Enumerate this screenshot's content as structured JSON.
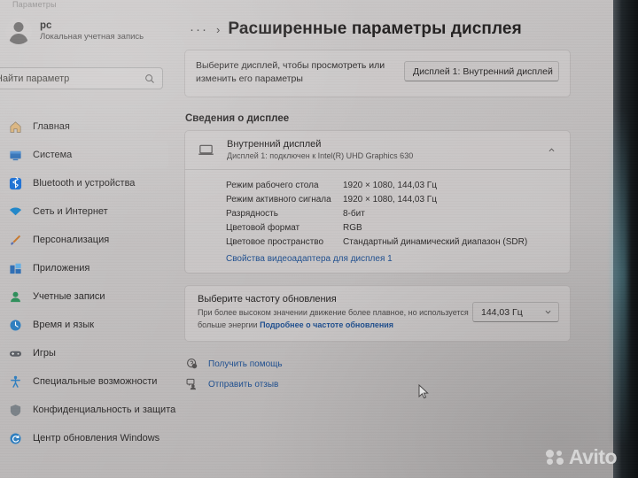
{
  "window": {
    "app_title": "Параметры"
  },
  "sidebar": {
    "account": {
      "name": "pc",
      "subtitle": "Локальная учетная запись",
      "avatar_icon": "user-avatar"
    },
    "search": {
      "value": "",
      "placeholder": "Найти параметр",
      "icon": "search-icon"
    },
    "items": [
      {
        "label": "Главная",
        "icon": "home-icon",
        "active": false
      },
      {
        "label": "Система",
        "icon": "system-icon",
        "active": true
      },
      {
        "label": "Bluetooth и устройства",
        "icon": "bluetooth-icon",
        "active": false
      },
      {
        "label": "Сеть и Интернет",
        "icon": "network-icon",
        "active": false
      },
      {
        "label": "Персонализация",
        "icon": "brush-icon",
        "active": false
      },
      {
        "label": "Приложения",
        "icon": "apps-icon",
        "active": false
      },
      {
        "label": "Учетные записи",
        "icon": "accounts-icon",
        "active": false
      },
      {
        "label": "Время и язык",
        "icon": "clock-icon",
        "active": false
      },
      {
        "label": "Игры",
        "icon": "gaming-icon",
        "active": false
      },
      {
        "label": "Специальные возможности",
        "icon": "accessibility-icon",
        "active": false
      },
      {
        "label": "Конфиденциальность и защита",
        "icon": "shield-icon",
        "active": false
      },
      {
        "label": "Центр обновления Windows",
        "icon": "update-icon",
        "active": false
      }
    ]
  },
  "content": {
    "breadcrumb": {
      "dots": "···",
      "separator": "›",
      "title": "Расширенные параметры дисплея"
    },
    "display_selector": {
      "description": "Выберите дисплей, чтобы просмотреть или изменить его параметры",
      "dropdown_value": "Дисплей 1: Внутренний дисплей",
      "chevron_icon": "chevron-down-icon"
    },
    "display_info": {
      "section_title": "Сведения о дисплее",
      "monitor_icon": "laptop-monitor-icon",
      "name": "Внутренний дисплей",
      "connection": "Дисплей 1: подключен к Intel(R) UHD Graphics 630",
      "collapse_icon": "chevron-up-icon",
      "specs": [
        {
          "key": "Режим рабочего стола",
          "value": "1920 × 1080, 144,03 Гц"
        },
        {
          "key": "Режим активного сигнала",
          "value": "1920 × 1080, 144,03 Гц"
        },
        {
          "key": "Разрядность",
          "value": "8-бит"
        },
        {
          "key": "Цветовой формат",
          "value": "RGB"
        },
        {
          "key": "Цветовое пространство",
          "value": "Стандартный динамический диапазон (SDR)"
        }
      ],
      "adapter_link": "Свойства видеоадаптера для дисплея 1"
    },
    "refresh_rate": {
      "title": "Выберите частоту обновления",
      "description": "При более высоком значении движение более плавное, но используется больше энергии",
      "learn_more": "Подробнее о частоте обновления",
      "dropdown_value": "144,03 Гц",
      "chevron_icon": "chevron-down-icon"
    },
    "help_links": [
      {
        "label": "Получить помощь",
        "icon": "get-help-icon"
      },
      {
        "label": "Отправить отзыв",
        "icon": "send-feedback-icon"
      }
    ]
  },
  "overlay": {
    "watermark": "Avito",
    "cursor_icon": "mouse-pointer-icon"
  },
  "colors": {
    "accent_link": "#1f4f8f",
    "sidebar_active": "#c6c4c4",
    "page_bg": "#bfbcbc",
    "bezel": "#121618"
  }
}
